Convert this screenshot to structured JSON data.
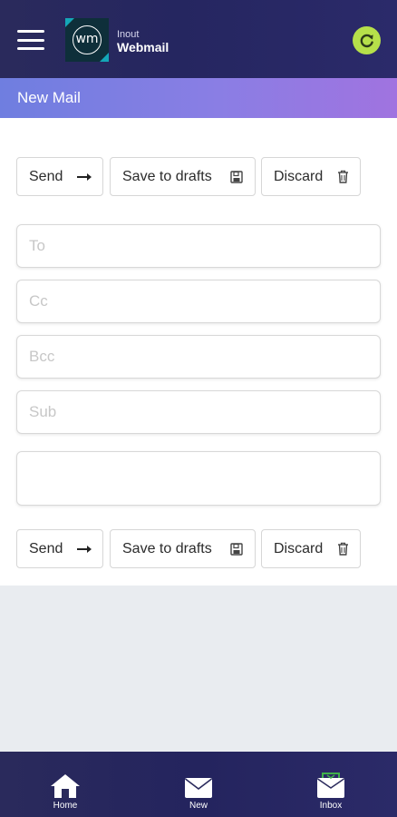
{
  "header": {
    "logo_text": "wm",
    "brand_small": "Inout",
    "brand_big": "Webmail",
    "menu_icon": "hamburger-menu-icon",
    "refresh_icon": "refresh-icon",
    "colors": {
      "header_bg": "#262660",
      "refresh_bg": "#b6e04a",
      "logo_accent": "#14a7b7"
    }
  },
  "title_bar": {
    "title": "New Mail"
  },
  "top_actions": {
    "send": "Send",
    "save": "Save to drafts",
    "discard": "Discard"
  },
  "form": {
    "to_placeholder": "To",
    "cc_placeholder": "Cc",
    "bcc_placeholder": "Bcc",
    "subject_placeholder": "Sub",
    "body_value": ""
  },
  "bottom_actions": {
    "send": "Send",
    "save": "Save to drafts",
    "discard": "Discard"
  },
  "nav": {
    "items": [
      {
        "label": "Home",
        "icon": "home-icon"
      },
      {
        "label": "New",
        "icon": "envelope-icon"
      },
      {
        "label": "Inbox",
        "icon": "inbox-icon"
      }
    ]
  }
}
